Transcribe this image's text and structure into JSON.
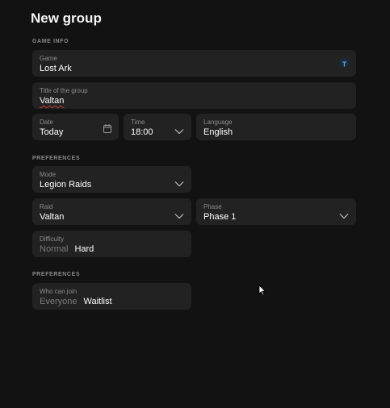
{
  "header": {
    "title": "New group"
  },
  "sections": {
    "game_info": "GAME INFO",
    "preferences_1": "PREFERENCES",
    "preferences_2": "PREFERENCES"
  },
  "game_info": {
    "game": {
      "label": "Game",
      "value": "Lost Ark",
      "icon": "lost-ark-game-icon"
    },
    "title": {
      "label": "Title of the group",
      "value": "Valtan"
    },
    "date": {
      "label": "Date",
      "value": "Today",
      "icon": "calendar-icon"
    },
    "time": {
      "label": "Time",
      "value": "18:00"
    },
    "language": {
      "label": "Language",
      "value": "English"
    }
  },
  "preferences": {
    "mode": {
      "label": "Mode",
      "value": "Legion Raids"
    },
    "raid": {
      "label": "Raid",
      "value": "Valtan"
    },
    "phase": {
      "label": "Phase",
      "value": "Phase 1"
    },
    "difficulty": {
      "label": "Difficulty",
      "options": [
        "Normal",
        "Hard"
      ],
      "selected": "Hard"
    }
  },
  "access": {
    "who_can_join": {
      "label": "Who can join",
      "options": [
        "Everyone",
        "Waitlist"
      ],
      "selected": "Waitlist"
    }
  },
  "colors": {
    "background": "#121212",
    "field": "#222222",
    "label": "#8c8c8c",
    "text": "#ffffff",
    "inactive_option": "#7a7a7a"
  }
}
